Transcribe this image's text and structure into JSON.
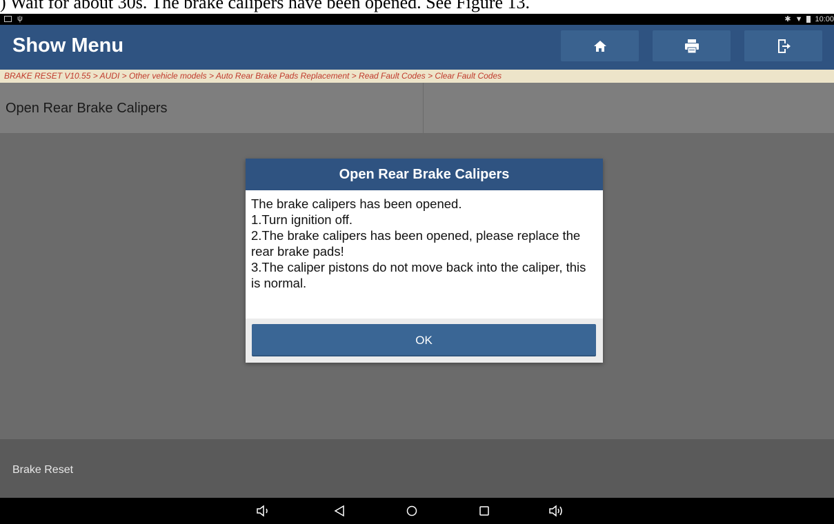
{
  "doc_caption": ") Wait for about 30s. The brake calipers have been opened. See Figure 13.",
  "status_bar": {
    "time": "10:00"
  },
  "header": {
    "title": "Show Menu"
  },
  "breadcrumb": "BRAKE RESET V10.55 > AUDI > Other vehicle models > Auto Rear Brake Pads Replacement > Read Fault Codes > Clear Fault Codes",
  "section": {
    "title": "Open Rear Brake Calipers"
  },
  "dialog": {
    "title": "Open Rear Brake Calipers",
    "lines": [
      "The brake calipers has been opened.",
      "1.Turn ignition off.",
      "2.The brake calipers has been opened, please replace the rear brake pads!",
      "3.The caliper pistons do not move back into the caliper, this is normal."
    ],
    "ok_label": "OK"
  },
  "footer": {
    "label": "Brake Reset"
  },
  "icons": {
    "header": [
      "home-icon",
      "print-icon",
      "exit-icon"
    ],
    "nav": [
      "volume-down-icon",
      "back-icon",
      "home-circle-icon",
      "recents-icon",
      "volume-up-icon"
    ]
  },
  "colors": {
    "header_bg": "#2f5381",
    "breadcrumb_bg": "#ede4c9",
    "breadcrumb_text": "#c0392b",
    "overlay_bg": "#6b6b6b",
    "ok_button": "#3a6695"
  }
}
